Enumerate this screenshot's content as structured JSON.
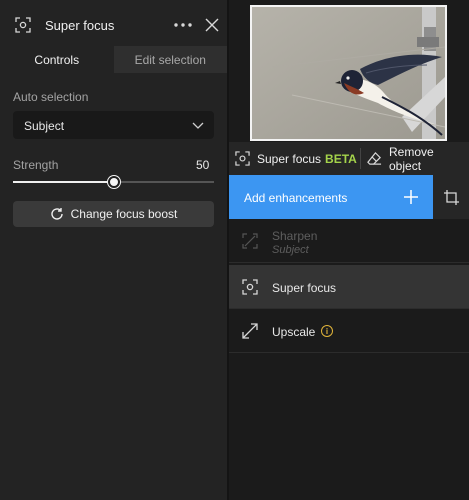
{
  "panel": {
    "title": "Super focus",
    "tabs": [
      {
        "label": "Controls",
        "active": true
      },
      {
        "label": "Edit selection",
        "active": false
      }
    ],
    "auto_selection": {
      "label": "Auto selection",
      "value": "Subject"
    },
    "strength": {
      "label": "Strength",
      "value": "50",
      "fraction": 0.5
    },
    "boost_button": "Change focus boost"
  },
  "toolbar": {
    "super_focus": "Super focus",
    "beta": "BETA",
    "remove_object": "Remove object"
  },
  "add_enhancements": "Add enhancements",
  "enhancements": [
    {
      "name": "Sharpen",
      "sub": "Subject",
      "icon": "sharpen-icon",
      "state": "disabled"
    },
    {
      "name": "Super focus",
      "icon": "focus-icon",
      "state": "selected"
    },
    {
      "name": "Upscale",
      "icon": "upscale-icon",
      "state": "normal",
      "info": "i"
    }
  ],
  "colors": {
    "accent": "#3c96f2",
    "beta": "#a4d34b",
    "info": "#e0b43a"
  }
}
